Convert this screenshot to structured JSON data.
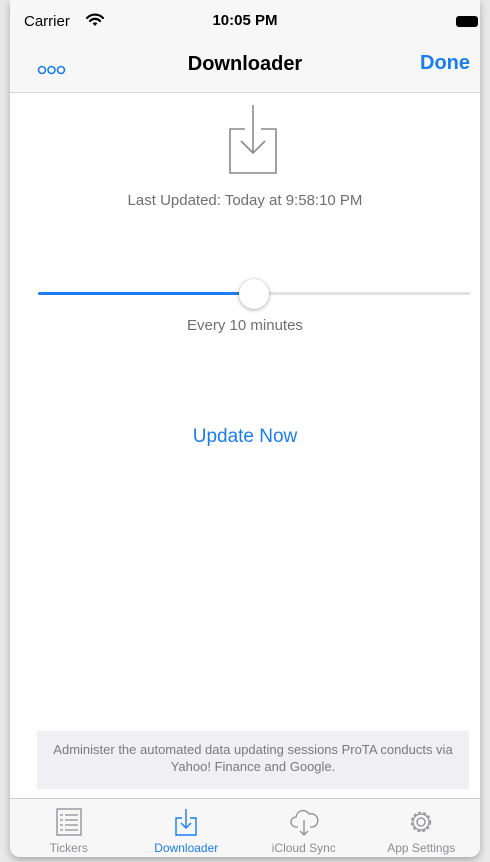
{
  "status_bar": {
    "carrier": "Carrier",
    "time": "10:05 PM"
  },
  "nav": {
    "title": "Downloader",
    "done_label": "Done"
  },
  "downloader": {
    "last_updated": "Last Updated:  Today at 9:58:10 PM",
    "slider_fraction": 0.5,
    "interval_label": "Every 10 minutes",
    "update_now_label": "Update Now",
    "info_text": "Administer the automated data updating sessions ProTA conducts via Yahoo! Finance and Google."
  },
  "tabs": [
    {
      "label": "Tickers",
      "icon": "list-icon",
      "active": false
    },
    {
      "label": "Downloader",
      "icon": "download-icon",
      "active": true
    },
    {
      "label": "iCloud Sync",
      "icon": "cloud-icon",
      "active": false
    },
    {
      "label": "App Settings",
      "icon": "gear-icon",
      "active": false
    }
  ],
  "colors": {
    "accent": "#1a7df0",
    "inactive": "#8e8e93",
    "secondary_text": "#6f6f6f",
    "bar_background": "#f7f7f7"
  }
}
